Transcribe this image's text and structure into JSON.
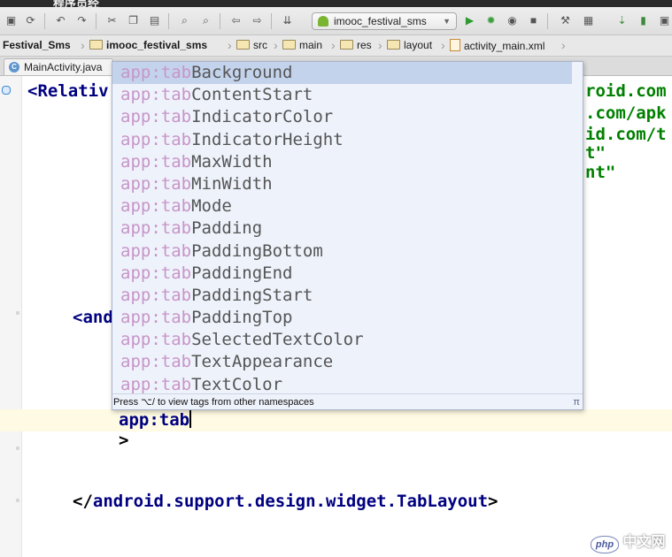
{
  "window": {
    "title": "程序员经"
  },
  "toolbar": {
    "run_config": "imooc_festival_sms"
  },
  "breadcrumb": [
    {
      "label": "Festival_Sms",
      "icon": ""
    },
    {
      "label": "imooc_festival_sms",
      "icon": "folder"
    },
    {
      "label": "src",
      "icon": "folder"
    },
    {
      "label": "main",
      "icon": "folder"
    },
    {
      "label": "res",
      "icon": "folder"
    },
    {
      "label": "layout",
      "icon": "folder"
    },
    {
      "label": "activity_main.xml",
      "icon": "xml-file"
    }
  ],
  "tabs": [
    {
      "label": "MainActivity.java",
      "icon": "class-icon"
    }
  ],
  "editor": {
    "line1_tag": "<Relativ",
    "right_frag_1": "roid.com",
    "right_frag_2": ".com/apk",
    "right_frag_3": "id.com/t",
    "right_frag_4": "t\"",
    "right_frag_5": "nt\"",
    "nested_tag": "<and",
    "typed_attr": "app:tab",
    "close_bracket": ">",
    "closing_tag_open": "</",
    "closing_tag_name": "android.support.design.widget.TabLayout",
    "closing_tag_end": ">"
  },
  "completion": {
    "prefix": "app:tab",
    "items": [
      "Background",
      "ContentStart",
      "IndicatorColor",
      "IndicatorHeight",
      "MaxWidth",
      "MinWidth",
      "Mode",
      "Padding",
      "PaddingBottom",
      "PaddingEnd",
      "PaddingStart",
      "PaddingTop",
      "SelectedTextColor",
      "TextAppearance",
      "TextColor"
    ],
    "selected_index": 0,
    "footer": "Press ⌥/ to view tags from other namespaces",
    "footer_icon": "π"
  },
  "watermark": {
    "logo": "php",
    "text": "中文网"
  },
  "colors": {
    "tag": "#000080",
    "string": "#008000",
    "prefix_highlight": "#c795c8",
    "selection": "#c4d3ec"
  }
}
